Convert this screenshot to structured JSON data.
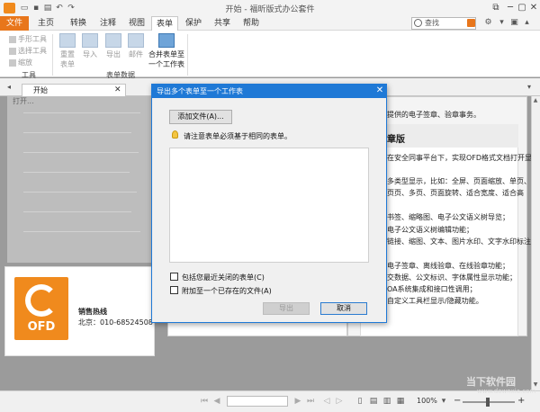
{
  "window": {
    "title": "开始 - 福昕版式办公套件",
    "controls": [
      "minimize",
      "maximize",
      "close"
    ]
  },
  "menu": {
    "tabs": [
      "文件",
      "主页",
      "转换",
      "注释",
      "视图",
      "表单",
      "保护",
      "共享",
      "帮助"
    ],
    "active_tab": "表单",
    "search_placeholder": "查找"
  },
  "ribbon": {
    "tools_group": {
      "label": "工具",
      "items": [
        "手形工具",
        "选择工具",
        "缩放"
      ]
    },
    "form_data_group": {
      "label": "表单数据",
      "buttons": [
        {
          "label_line1": "重置",
          "label_line2": "表单",
          "enabled": false
        },
        {
          "label_line1": "导入",
          "label_line2": "",
          "enabled": false
        },
        {
          "label_line1": "导出",
          "label_line2": "",
          "enabled": false
        },
        {
          "label_line1": "邮件",
          "label_line2": "",
          "enabled": false
        },
        {
          "label_line1": "合并表单至",
          "label_line2": "一个工作表",
          "enabled": true
        }
      ]
    }
  },
  "doc_tab": {
    "label": "开始"
  },
  "start_page": {
    "left_heading": "打开...",
    "ad": {
      "logo_text": "OFD",
      "hotline_title": "销售热线",
      "hotline_phone": "北京：010-68524508"
    },
    "right": {
      "top_line1": "提供的电子签章、验章事务。",
      "card_title": "章版",
      "lines": [
        "在安全同事平台下，实现OFD格式文档打开显",
        "多类型显示，比如：全屏、页面缩放、单页、",
        "页页、多页、页面旋转、适合宽度、适合高",
        "书签、缩略图、电子公文语义树导览；",
        "电子公文语义树编辑功能；",
        "链接、缩图、文本、图片水印、文字水印标注",
        "电子签章、离线验章、在线验章功能；",
        "交数据、公文标识、字体属性显示功能；",
        "OA系统集成和接口性调用；",
        "自定义工具栏显示/隐藏功能。"
      ]
    }
  },
  "dialog": {
    "title": "导出多个表单至一个工作表",
    "add_file_button": "添加文件(A)...",
    "note": "请注意表单必须基于相同的表单。",
    "checkbox_include_recent": "包括您最近关闭的表单(C)",
    "checkbox_append_existing": "附加至一个已存在的文件(A)",
    "export_button": "导出",
    "cancel_button": "取消"
  },
  "statusbar": {
    "zoom": "100%"
  },
  "watermark": {
    "line1": "当下软件园",
    "line2": "www.downxia.com"
  },
  "colors": {
    "accent_orange": "#e8761b",
    "dialog_blue": "#1f79d6"
  }
}
